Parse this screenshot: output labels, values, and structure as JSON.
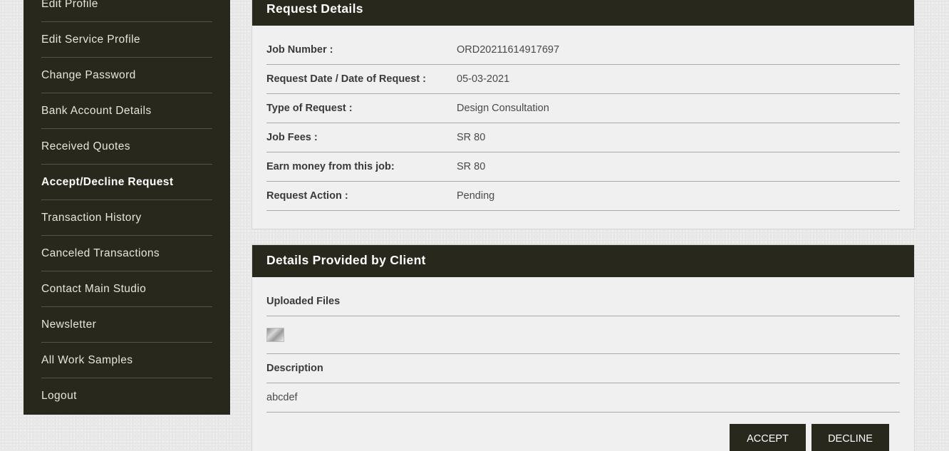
{
  "sidebar": {
    "items": [
      {
        "label": "Edit Profile"
      },
      {
        "label": "Edit Service Profile"
      },
      {
        "label": "Change Password"
      },
      {
        "label": "Bank Account Details"
      },
      {
        "label": "Received Quotes"
      },
      {
        "label": "Accept/Decline Request",
        "active": true
      },
      {
        "label": "Transaction History"
      },
      {
        "label": "Canceled Transactions"
      },
      {
        "label": "Contact Main Studio"
      },
      {
        "label": "Newsletter"
      },
      {
        "label": "All Work Samples"
      },
      {
        "label": "Logout"
      }
    ]
  },
  "request_details": {
    "title": "Request Details",
    "rows": [
      {
        "label": "Job Number :",
        "value": "ORD20211614917697"
      },
      {
        "label": "Request Date / Date of Request :",
        "value": "05-03-2021"
      },
      {
        "label": "Type of Request :",
        "value": "Design Consultation"
      },
      {
        "label": "Job Fees :",
        "value": "SR 80"
      },
      {
        "label": "Earn money from this job:",
        "value": "SR 80"
      },
      {
        "label": "Request Action :",
        "value": "Pending"
      }
    ]
  },
  "client_details": {
    "title": "Details Provided by Client",
    "uploaded_files_label": "Uploaded Files",
    "description_label": "Description",
    "description": "abcdef"
  },
  "actions": {
    "accept_label": "ACCEPT",
    "decline_label": "DECLINE"
  },
  "colors": {
    "dark": "#28281c",
    "panel_bg": "#f0f0f0",
    "page_bg": "#e9e9e9"
  }
}
